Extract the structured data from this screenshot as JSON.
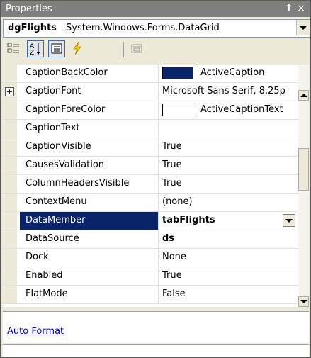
{
  "window": {
    "title": "Properties",
    "pin_glyph": "†",
    "close_glyph": "×"
  },
  "object_selector": {
    "name": "dgFlights",
    "type": "System.Windows.Forms.DataGrid"
  },
  "toolbar": {
    "buttons": [
      {
        "icon": "categorized-icon",
        "pressed": false
      },
      {
        "icon": "alphabetical-icon",
        "pressed": true
      },
      {
        "icon": "properties-icon",
        "pressed": true
      },
      {
        "icon": "events-icon",
        "pressed": false
      },
      {
        "icon": "property-pages-icon",
        "pressed": false
      }
    ]
  },
  "properties": [
    {
      "name": "CaptionBackColor",
      "value": "ActiveCaption",
      "swatch": "#0a246a"
    },
    {
      "name": "CaptionFont",
      "value": "Microsoft Sans Serif, 8.25p",
      "expandable": true
    },
    {
      "name": "CaptionForeColor",
      "value": "ActiveCaptionText",
      "swatch": "#ffffff"
    },
    {
      "name": "CaptionText",
      "value": ""
    },
    {
      "name": "CaptionVisible",
      "value": "True"
    },
    {
      "name": "CausesValidation",
      "value": "True"
    },
    {
      "name": "ColumnHeadersVisible",
      "value": "True"
    },
    {
      "name": "ContextMenu",
      "value": "(none)"
    },
    {
      "name": "DataMember",
      "value": "tabFlights",
      "selected": true,
      "bold": true,
      "dropdown": true
    },
    {
      "name": "DataSource",
      "value": "ds",
      "bold": true
    },
    {
      "name": "Dock",
      "value": "None"
    },
    {
      "name": "Enabled",
      "value": "True"
    },
    {
      "name": "FlatMode",
      "value": "False"
    }
  ],
  "bottom": {
    "auto_format": "Auto Format"
  },
  "colors": {
    "selection": "#0a246a",
    "title_bg": "#7f7f7f",
    "link": "#0000cc"
  }
}
